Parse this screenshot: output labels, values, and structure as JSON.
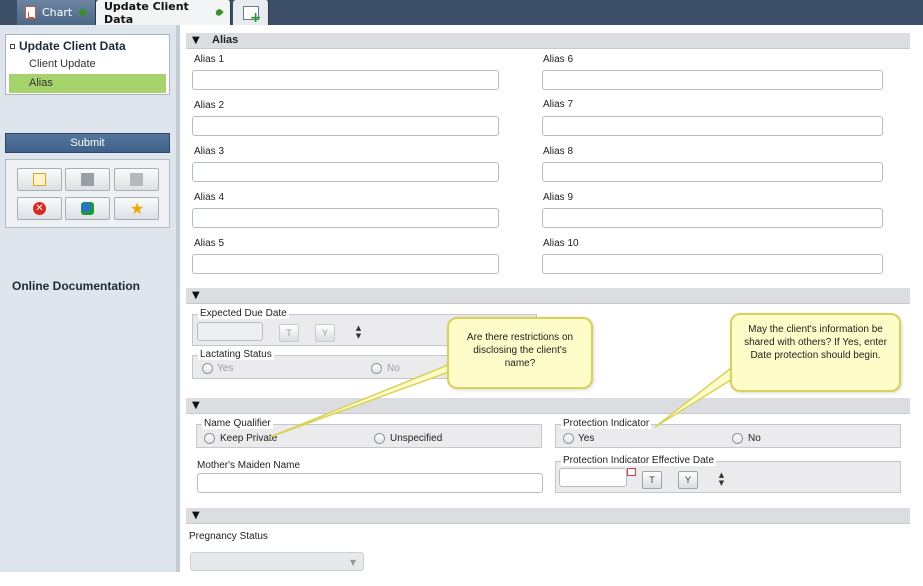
{
  "tabs": [
    {
      "label": "Chart",
      "active": false
    },
    {
      "label": "Update Client Data",
      "active": true
    }
  ],
  "add_tab_icon": "add-tab-icon",
  "nav": {
    "title": "Update Client Data",
    "items": [
      {
        "label": "Client Update",
        "active": false
      },
      {
        "label": "Alias",
        "active": true
      }
    ]
  },
  "submit_label": "Submit",
  "toolbox": {
    "buttons": [
      "new-document-icon",
      "save-icon",
      "note-icon",
      "cancel-icon",
      "merge-people-icon",
      "favorite-star-icon"
    ]
  },
  "online_documentation": "Online Documentation",
  "sections": {
    "alias": {
      "title": "Alias",
      "fields_left": [
        {
          "label": "Alias 1",
          "value": ""
        },
        {
          "label": "Alias 2",
          "value": ""
        },
        {
          "label": "Alias 3",
          "value": ""
        },
        {
          "label": "Alias 4",
          "value": ""
        },
        {
          "label": "Alias 5",
          "value": ""
        }
      ],
      "fields_right": [
        {
          "label": "Alias 6",
          "value": ""
        },
        {
          "label": "Alias 7",
          "value": ""
        },
        {
          "label": "Alias 8",
          "value": ""
        },
        {
          "label": "Alias 9",
          "value": ""
        },
        {
          "label": "Alias 10",
          "value": ""
        }
      ]
    },
    "pregnancy_group": {
      "expected_due_date": {
        "label": "Expected Due Date",
        "today_btn": "T",
        "yesterday_btn": "Y"
      },
      "lactating_status": {
        "label": "Lactating Status",
        "options": [
          "Yes",
          "No"
        ]
      }
    },
    "privacy_group": {
      "name_qualifier": {
        "label": "Name Qualifier",
        "options": [
          "Keep Private",
          "Unspecified"
        ]
      },
      "protection_indicator": {
        "label": "Protection Indicator",
        "options": [
          "Yes",
          "No"
        ]
      },
      "mothers_maiden_name": {
        "label": "Mother's Maiden Name",
        "value": ""
      },
      "protection_effective_date": {
        "label": "Protection Indicator Effective Date",
        "today_btn": "T",
        "yesterday_btn": "Y"
      }
    },
    "pregnancy": {
      "status_label": "Pregnancy Status",
      "status_value": ""
    }
  },
  "callouts": {
    "name_restriction": "Are there restrictions on disclosing the client's name?",
    "shared_info": "May the client's information be shared with others? If Yes, enter Date protection should begin."
  },
  "colors": {
    "accent_green": "#a6d36c",
    "tab_bar": "#3d4f66",
    "submit_blue": "#4a6a92",
    "callout_fill": "#fefcc8"
  }
}
